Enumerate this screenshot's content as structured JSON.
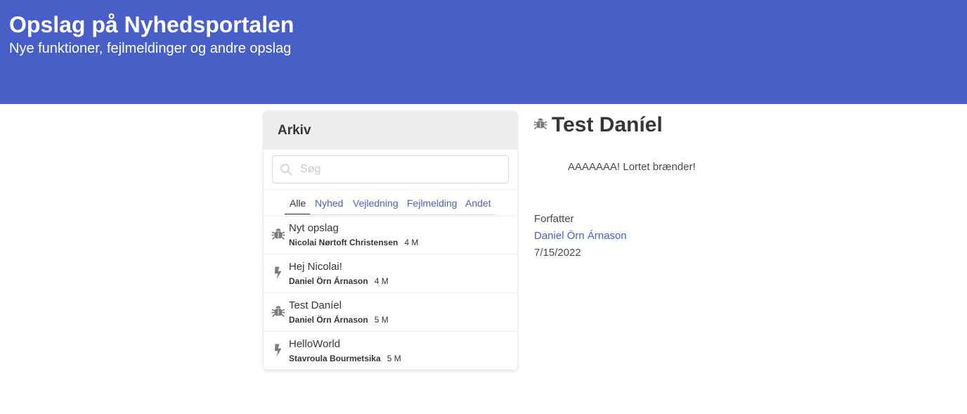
{
  "header": {
    "title": "Opslag på Nyhedsportalen",
    "subtitle": "Nye funktioner, fejlmeldinger og andre opslag"
  },
  "archive": {
    "heading": "Arkiv",
    "search": {
      "placeholder": "Søg",
      "value": ""
    },
    "tabs": [
      {
        "label": "Alle",
        "active": true
      },
      {
        "label": "Nyhed",
        "active": false
      },
      {
        "label": "Vejledning",
        "active": false
      },
      {
        "label": "Fejlmelding",
        "active": false
      },
      {
        "label": "Andet",
        "active": false
      }
    ],
    "items": [
      {
        "title": "Nyt opslag",
        "author": "Nicolai Nørtoft Christensen",
        "age": "4 M",
        "icon": "bug-icon"
      },
      {
        "title": "Hej Nicolai!",
        "author": "Daniel Örn Árnason",
        "age": "4 M",
        "icon": "bolt-icon"
      },
      {
        "title": "Test Daníel",
        "author": "Daniel Örn Árnason",
        "age": "5 M",
        "icon": "bug-icon"
      },
      {
        "title": "HelloWorld",
        "author": "Stavroula Bourmetsika",
        "age": "5 M",
        "icon": "bolt-icon"
      }
    ]
  },
  "detail": {
    "icon": "bug-icon",
    "title": "Test Daníel",
    "body": "AAAAAAA! Lortet brænder!",
    "author_label": "Forfatter",
    "author": "Daniel Örn Árnason",
    "date": "7/15/2022"
  },
  "colors": {
    "banner": "#485fc7",
    "link": "#485fc7",
    "icon": "#7a7a7a"
  }
}
